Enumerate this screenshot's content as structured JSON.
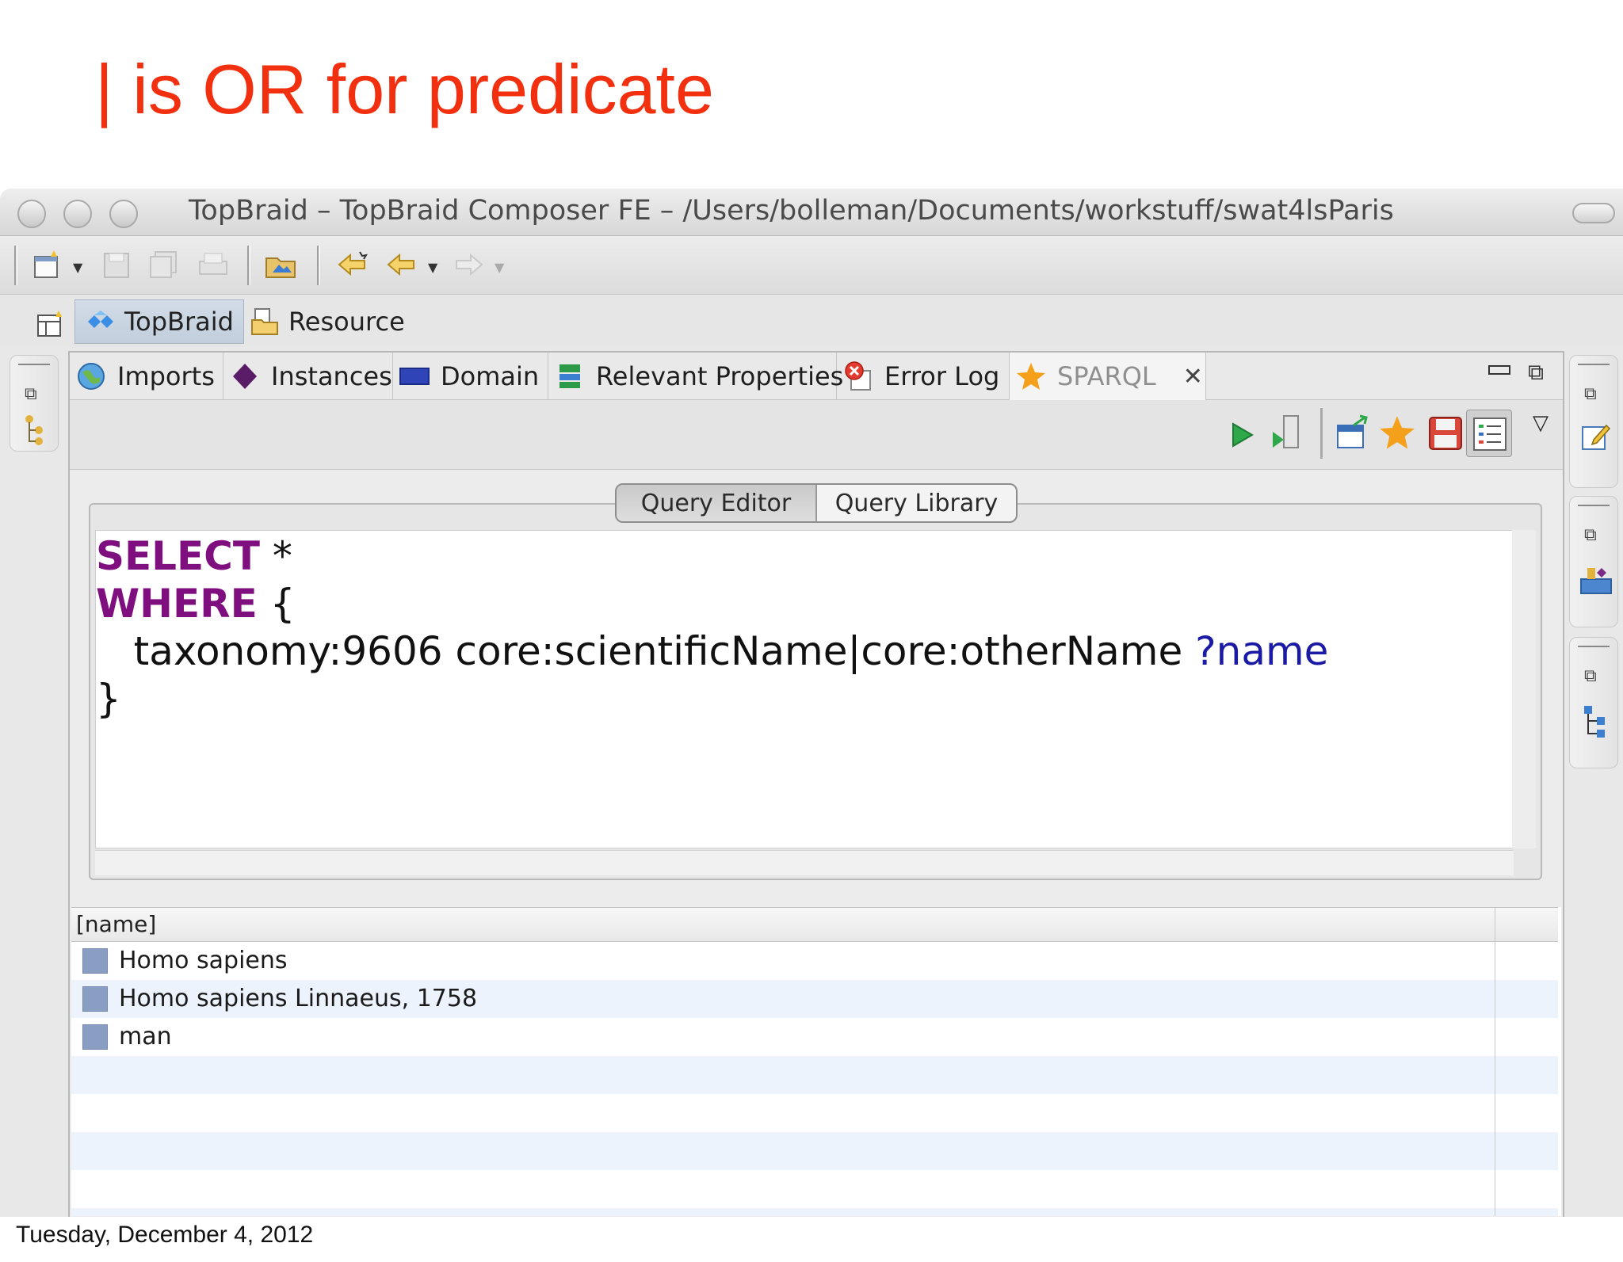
{
  "slide": {
    "title": "| is OR for predicate",
    "date": "Tuesday, December 4, 2012"
  },
  "window": {
    "title": "TopBraid – TopBraid Composer FE – /Users/bolleman/Documents/workstuff/swat4lsParis"
  },
  "perspectives": [
    {
      "label": "TopBraid",
      "icon": "topbraid-icon"
    },
    {
      "label": "Resource",
      "icon": "resource-icon"
    }
  ],
  "tabs": [
    {
      "label": "Imports",
      "icon": "globe-icon"
    },
    {
      "label": "Instances",
      "icon": "diamond-icon"
    },
    {
      "label": "Domain",
      "icon": "domain-icon"
    },
    {
      "label": "Relevant Properties",
      "icon": "properties-icon"
    },
    {
      "label": "Error Log",
      "icon": "error-icon"
    },
    {
      "label": "SPARQL",
      "icon": "star-icon"
    }
  ],
  "query_tabs": {
    "editor": "Query Editor",
    "library": "Query Library"
  },
  "query": {
    "line1_kw": "SELECT",
    "line1_rest": " *",
    "line2_kw": "WHERE",
    "line2_rest": " {",
    "line3_text": "   taxonomy:9606 core:scientificName|core:otherName ",
    "line3_var": "?name",
    "line4": "}"
  },
  "results": {
    "column": "[name]",
    "rows": [
      "Homo sapiens",
      "Homo sapiens Linnaeus, 1758",
      "man"
    ]
  },
  "colors": {
    "title": "#f2300f",
    "keyword": "#7f0f7f",
    "variable": "#1a1aa5",
    "row_alt": "#edf3fc"
  }
}
